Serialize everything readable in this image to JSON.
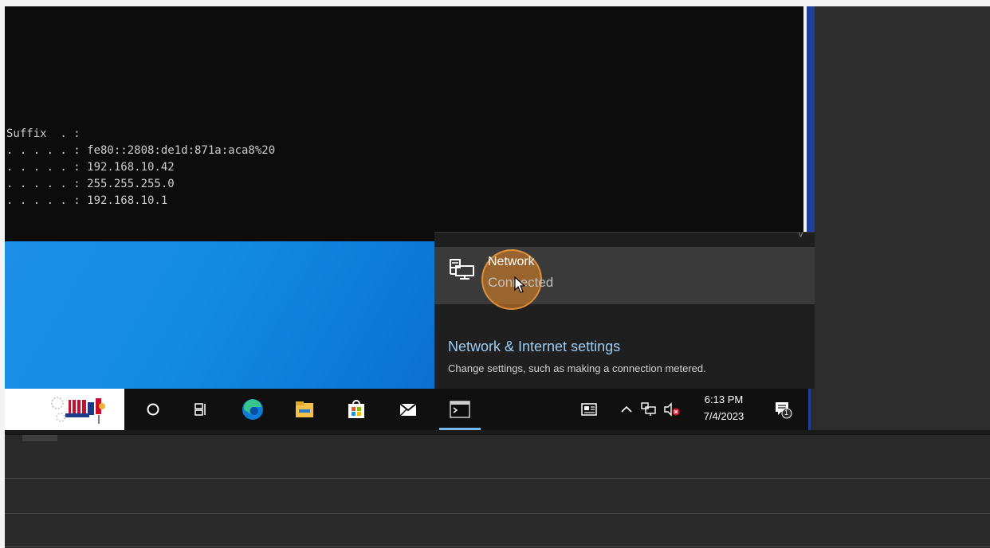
{
  "console": {
    "lines": [
      "Suffix  . :",
      ". . . . . : fe80::2808:de1d:871a:aca8%20",
      ". . . . . : 192.168.10.42",
      ". . . . . : 255.255.255.0",
      ". . . . . : 192.168.10.1"
    ]
  },
  "network_flyout": {
    "network_name": "Network",
    "network_status": "Connected",
    "settings_link": "Network & Internet settings",
    "settings_description": "Change settings, such as making a connection metered."
  },
  "taskbar": {
    "pinned_apps": [
      "cortana-icon",
      "task-view-icon",
      "edge-icon",
      "file-explorer-icon",
      "store-icon",
      "mail-icon",
      "command-prompt-icon"
    ],
    "tray_icons": [
      "news-icon",
      "chevron-up-icon",
      "network-icon",
      "volume-muted-icon"
    ],
    "clock_time": "6:13 PM",
    "clock_date": "7/4/2023",
    "notification_count": "1"
  },
  "colors": {
    "accent_blue": "#76b9ed",
    "link_blue": "#9ccdf5",
    "highlight_orange": "#e78624",
    "wallpaper_blue": "#138be2"
  }
}
